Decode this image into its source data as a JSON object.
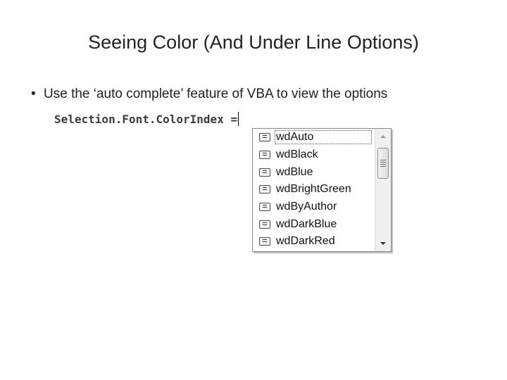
{
  "slide": {
    "title": "Seeing Color (And Under Line Options)",
    "bullet_symbol": "•",
    "bullet_text": "Use the ‘auto complete’ feature of VBA to view the options"
  },
  "code": {
    "text": "Selection.Font.ColorIndex ="
  },
  "autocomplete": {
    "selected_index": 0,
    "items": [
      {
        "label": "wdAuto",
        "icon": "constant-icon"
      },
      {
        "label": "wdBlack",
        "icon": "constant-icon"
      },
      {
        "label": "wdBlue",
        "icon": "constant-icon"
      },
      {
        "label": "wdBrightGreen",
        "icon": "constant-icon"
      },
      {
        "label": "wdByAuthor",
        "icon": "constant-icon"
      },
      {
        "label": "wdDarkBlue",
        "icon": "constant-icon"
      },
      {
        "label": "wdDarkRed",
        "icon": "constant-icon"
      }
    ],
    "scrollbar": {
      "up_icon": "scroll-up-arrow-icon",
      "down_icon": "scroll-down-arrow-icon",
      "thumb_icon": "scroll-grip-icon"
    }
  }
}
